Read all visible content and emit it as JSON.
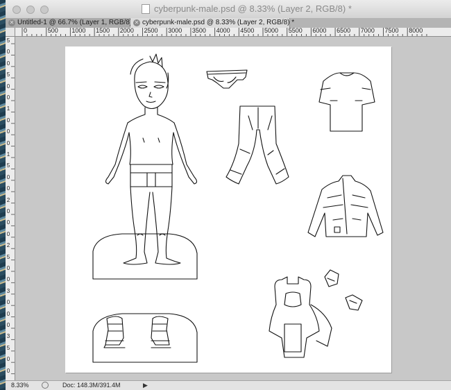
{
  "window": {
    "title": "cyberpunk-male.psd @ 8.33% (Layer 2, RGB/8) *"
  },
  "tabs": [
    {
      "label": "Untitled-1 @ 66.7% (Layer 1, RGB/8) *"
    },
    {
      "label": "cyberpunk-male.psd @ 8.33% (Layer 2, RGB/8) *"
    }
  ],
  "ruler": {
    "horizontal": [
      "0",
      "500",
      "1000",
      "1500",
      "2000",
      "2500",
      "3000",
      "3500",
      "4000",
      "4500",
      "5000",
      "5500",
      "6000",
      "6500",
      "7000",
      "7500",
      "8000"
    ],
    "vertical": [
      "5",
      "0",
      "0",
      "5",
      "0",
      "0",
      "1",
      "0",
      "0",
      "0",
      "1",
      "5",
      "0",
      "0",
      "2",
      "0",
      "0",
      "0",
      "2",
      "5",
      "0",
      "0",
      "3",
      "0",
      "0",
      "0",
      "3",
      "5",
      "0",
      "0"
    ]
  },
  "status": {
    "zoom": "8.33%",
    "doc": "Doc: 148.3M/391.4M"
  },
  "icons": {
    "close": "close-icon",
    "document": "document-icon",
    "arrow": "arrow-right-icon"
  }
}
